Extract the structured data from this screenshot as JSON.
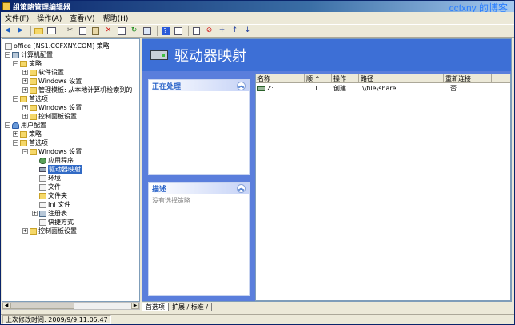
{
  "window": {
    "title": "组策略管理编辑器",
    "watermark": "ccfxny 的博客"
  },
  "menu": [
    "文件(F)",
    "操作(A)",
    "查看(V)",
    "帮助(H)"
  ],
  "toolbar_icons": [
    "back-icon",
    "forward-icon",
    "up-folder-icon",
    "show-tree-icon",
    "cut-icon",
    "copy-icon",
    "paste-icon",
    "delete-icon",
    "properties-icon",
    "refresh-icon",
    "export-icon",
    "help-icon",
    "help-topic-icon",
    "new-icon",
    "stop-icon",
    "add-icon",
    "move-up-icon",
    "move-down-icon"
  ],
  "tree": {
    "root": "office [NS1.CCFXNY.COM] 策略",
    "computer_config": "计算机配置",
    "policies": "策略",
    "software_settings": "软件设置",
    "windows_settings": "Windows 设置",
    "admin_templates": "管理模板: 从本地计算机检索到的",
    "preferences": "首选项",
    "pref_windows_settings": "Windows 设置",
    "pref_control_panel": "控制面板设置",
    "user_config": "用户配置",
    "u_policies": "策略",
    "u_preferences": "首选项",
    "u_windows_settings": "Windows 设置",
    "applications": "应用程序",
    "drive_maps": "驱动器映射",
    "environment": "环境",
    "files": "文件",
    "folders": "文件夹",
    "ini_files": "Ini 文件",
    "registry": "注册表",
    "shortcuts": "快捷方式",
    "u_control_panel": "控制面板设置"
  },
  "content": {
    "banner_title": "驱动器映射",
    "processing_panel": {
      "title": "正在处理"
    },
    "description_panel": {
      "title": "描述",
      "body": "没有选择策略"
    },
    "columns": [
      "名称",
      "顺 ^",
      "操作",
      "路径",
      "重新连接"
    ],
    "rows": [
      {
        "name": "Z:",
        "order": "1",
        "action": "创建",
        "path": "\\\\file\\share",
        "reconnect": "否"
      }
    ]
  },
  "tabs": [
    "首选项",
    "扩展 / 标准 /"
  ],
  "status": {
    "last_modified": "上次修改时间: 2009/9/9 11:05:47"
  }
}
